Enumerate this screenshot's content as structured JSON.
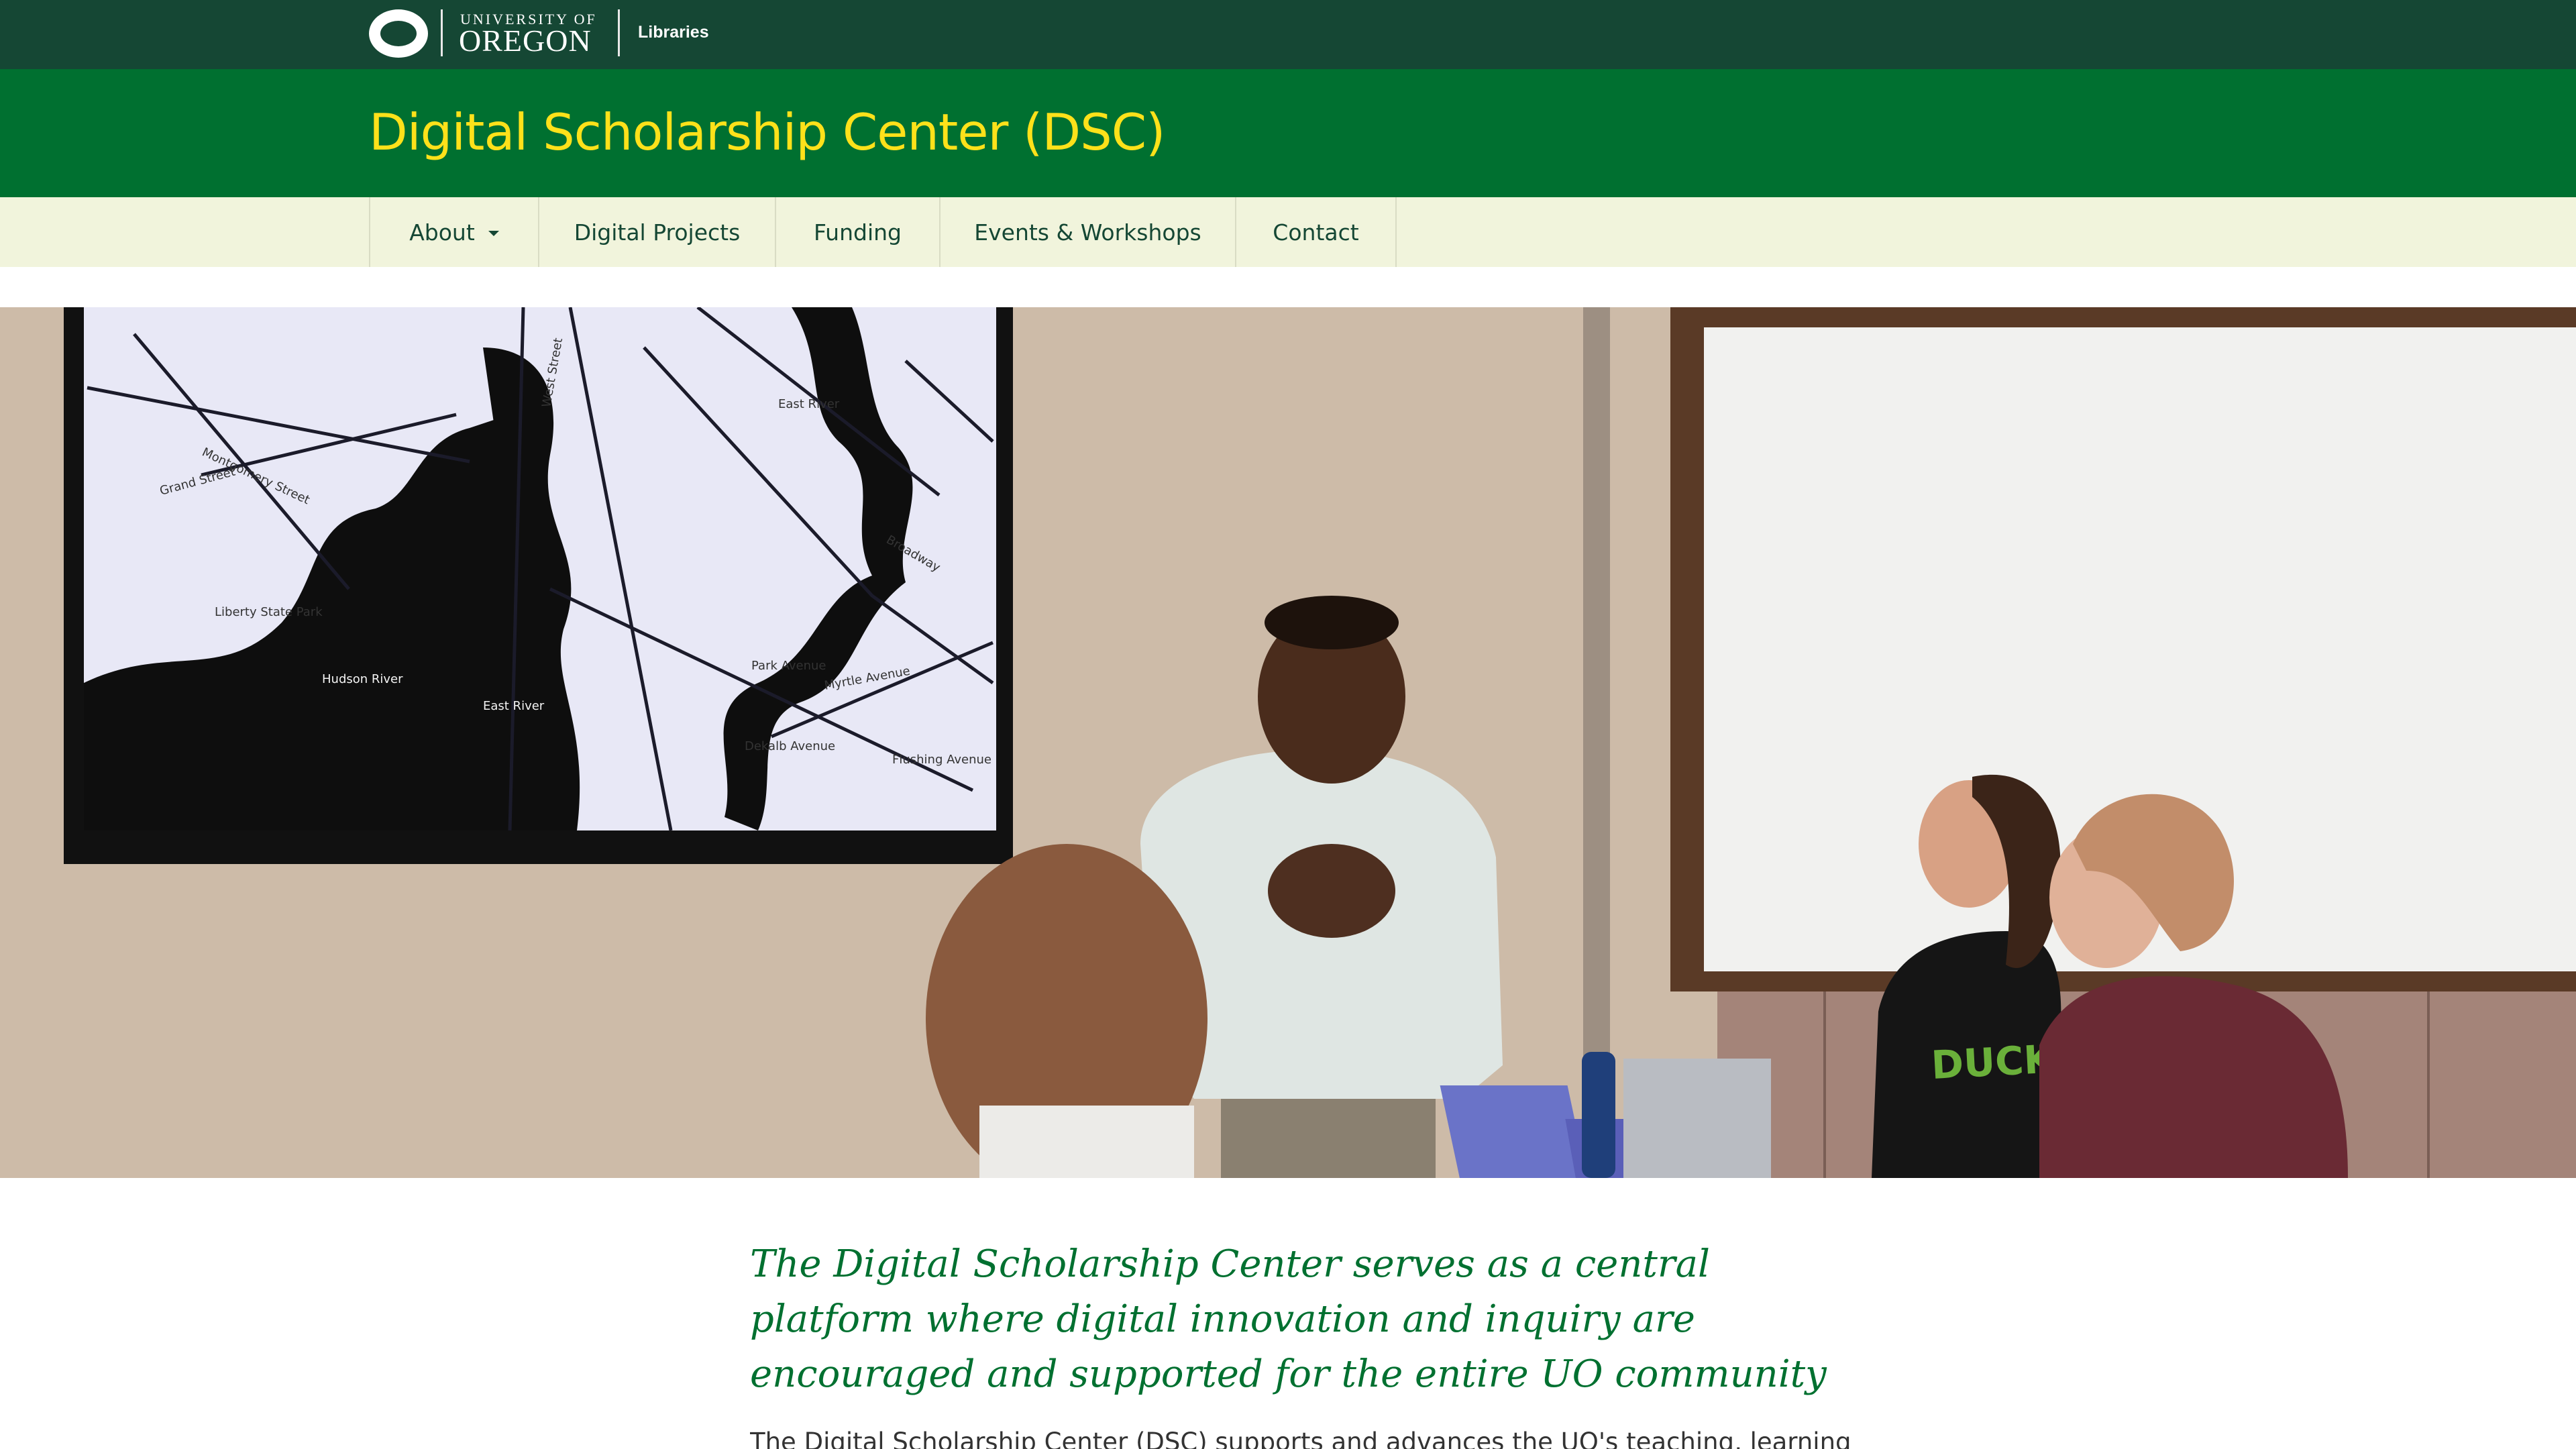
{
  "header": {
    "logo_icon": "uo-o-logo",
    "university_line": "UNIVERSITY OF",
    "oregon_line": "OREGON",
    "libraries": "Libraries",
    "colors": {
      "topbar": "#154734",
      "banner": "#007030",
      "title": "#fee11a",
      "nav_bg": "#f1f4dc"
    }
  },
  "site": {
    "title": "Digital Scholarship Center (DSC)"
  },
  "nav": {
    "items": [
      {
        "label": "About"
      },
      {
        "label": "Digital Projects"
      },
      {
        "label": "Funding"
      },
      {
        "label": "Events & Workshops"
      },
      {
        "label": "Contact"
      }
    ]
  },
  "hero": {
    "map_labels": {
      "west_street": "West Street",
      "east_river_top": "East River",
      "liberty_state_park": "Liberty State Park",
      "hudson_river": "Hudson River",
      "east_river_bottom": "East River",
      "montgomery_street": "Montgomery Street",
      "grand_street": "Grand Street",
      "broadway": "Broadway",
      "myrtle_avenue": "Myrtle Avenue",
      "dekalb_avenue": "Dekalb Avenue",
      "flushing_avenue": "Flushing Avenue",
      "park_avenue": "Park Avenue"
    },
    "shirt_text": "DUCKS"
  },
  "intro": {
    "lead": "The Digital Scholarship Center serves as a central platform where digital innovation and inquiry are encouraged and supported for the entire UO community",
    "body": "The Digital Scholarship Center (DSC) supports and advances the UO's teaching, learning, and"
  }
}
